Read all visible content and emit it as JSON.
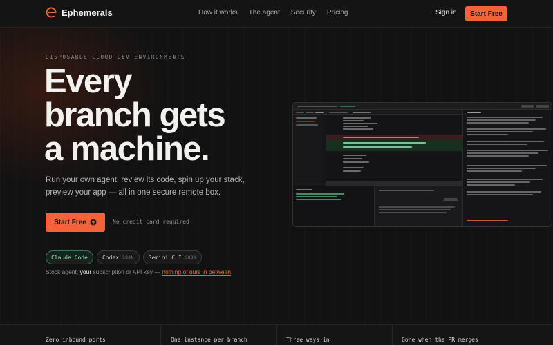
{
  "nav": {
    "brand": "Ephemerals",
    "links": [
      "How it works",
      "The agent",
      "Security",
      "Pricing"
    ],
    "signin": "Sign in",
    "cta": "Start Free"
  },
  "hero": {
    "eyebrow": "DISPOSABLE CLOUD DEV ENVIRONMENTS",
    "headline": [
      "Every",
      "branch gets",
      "a machine."
    ],
    "subtext": "Run your own agent, review its code, spin up your stack, preview your app — all in one secure remote box.",
    "cta": "Start Free",
    "cta_note": "No credit card required",
    "agents": [
      {
        "name": "Claude Code",
        "tag": ""
      },
      {
        "name": "Codex",
        "tag": "SOON"
      },
      {
        "name": "Gemini CLI",
        "tag": "SOON"
      }
    ],
    "stock": {
      "pre": "Stock agent, ",
      "your": "your",
      "mid": " subscription or API key — ",
      "link": "nothing of ours in between",
      "post": "."
    }
  },
  "features": [
    "Zero inbound ports",
    "One instance per branch",
    "Three ways in",
    "Gone when the PR merges"
  ],
  "colors": {
    "accent": "#f4623a",
    "background": "#121212",
    "pill_active": "#9fe0bd"
  },
  "icons": {
    "logo": "ephemerals-logo-icon",
    "cta": "github-icon"
  }
}
